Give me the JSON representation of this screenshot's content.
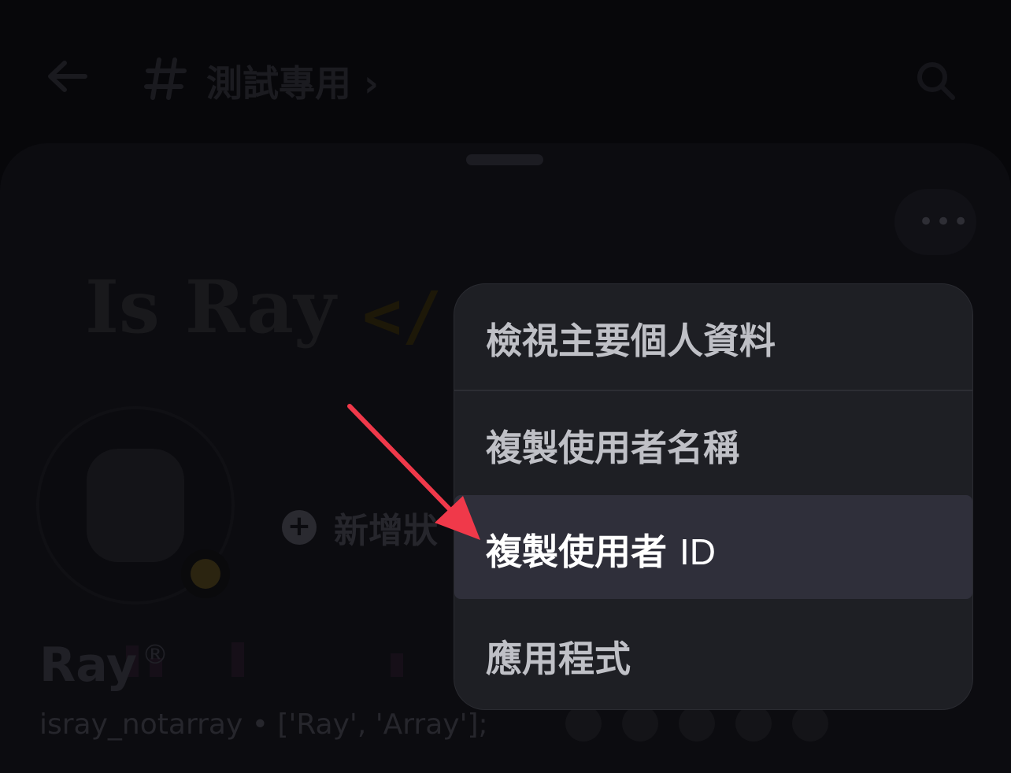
{
  "header": {
    "channel_title": "測試專用 ›"
  },
  "banner": {
    "title": "Is Ray",
    "code": "</"
  },
  "profile": {
    "add_status_label": "新增狀",
    "add_status_icon": "+",
    "display_name": "Ray",
    "registered_mark": "®",
    "username_line": "isray_notarray • ['Ray', 'Array'];"
  },
  "menu": {
    "items": [
      {
        "label": "檢視主要個人資料",
        "icon": ""
      },
      {
        "label": "複製使用者名稱",
        "icon": ""
      },
      {
        "label": "複製使用者",
        "suffix": "ID",
        "highlighted": true
      },
      {
        "label": "應用程式",
        "icon": ""
      }
    ]
  },
  "annotation": {
    "arrow_color": "#f0394a"
  }
}
